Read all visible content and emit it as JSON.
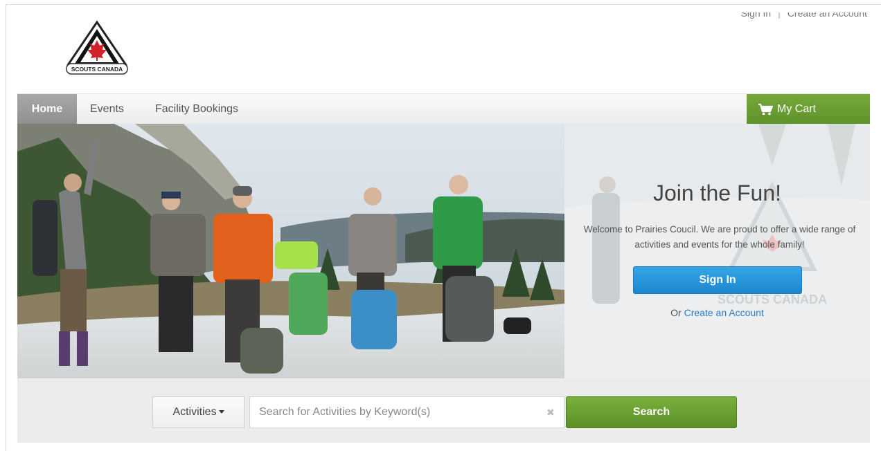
{
  "header": {
    "logo_text": "SCOUTS CANADA",
    "sign_in_link": "Sign In",
    "separator": "|",
    "create_account_link": "Create an Account"
  },
  "nav": {
    "items": [
      {
        "label": "Home",
        "active": true
      },
      {
        "label": "Events",
        "active": false
      },
      {
        "label": "Facility Bookings",
        "active": false
      }
    ],
    "cart_label": "My Cart",
    "cart_icon": "shopping-cart-icon"
  },
  "hero": {
    "title": "Join the Fun!",
    "welcome_text": "Welcome to Prairies Coucil. We are proud to offer a wide range of activities and events for the whole family!",
    "sign_in_button": "Sign In",
    "or_text": "Or",
    "create_account_link": "Create an Account",
    "watermark_text": "SCOUTS CANADA"
  },
  "search": {
    "category_label": "Activities",
    "placeholder": "Search for Activities by Keyword(s)",
    "value": "",
    "clear_icon": "clear-x-icon",
    "search_button": "Search"
  },
  "colors": {
    "nav_active": "#9a9a9a",
    "cart_green": "#6a9e32",
    "signin_blue": "#2596dc",
    "search_green": "#6aa131",
    "link_blue": "#2a7bc0",
    "logo_red": "#d0232a"
  }
}
